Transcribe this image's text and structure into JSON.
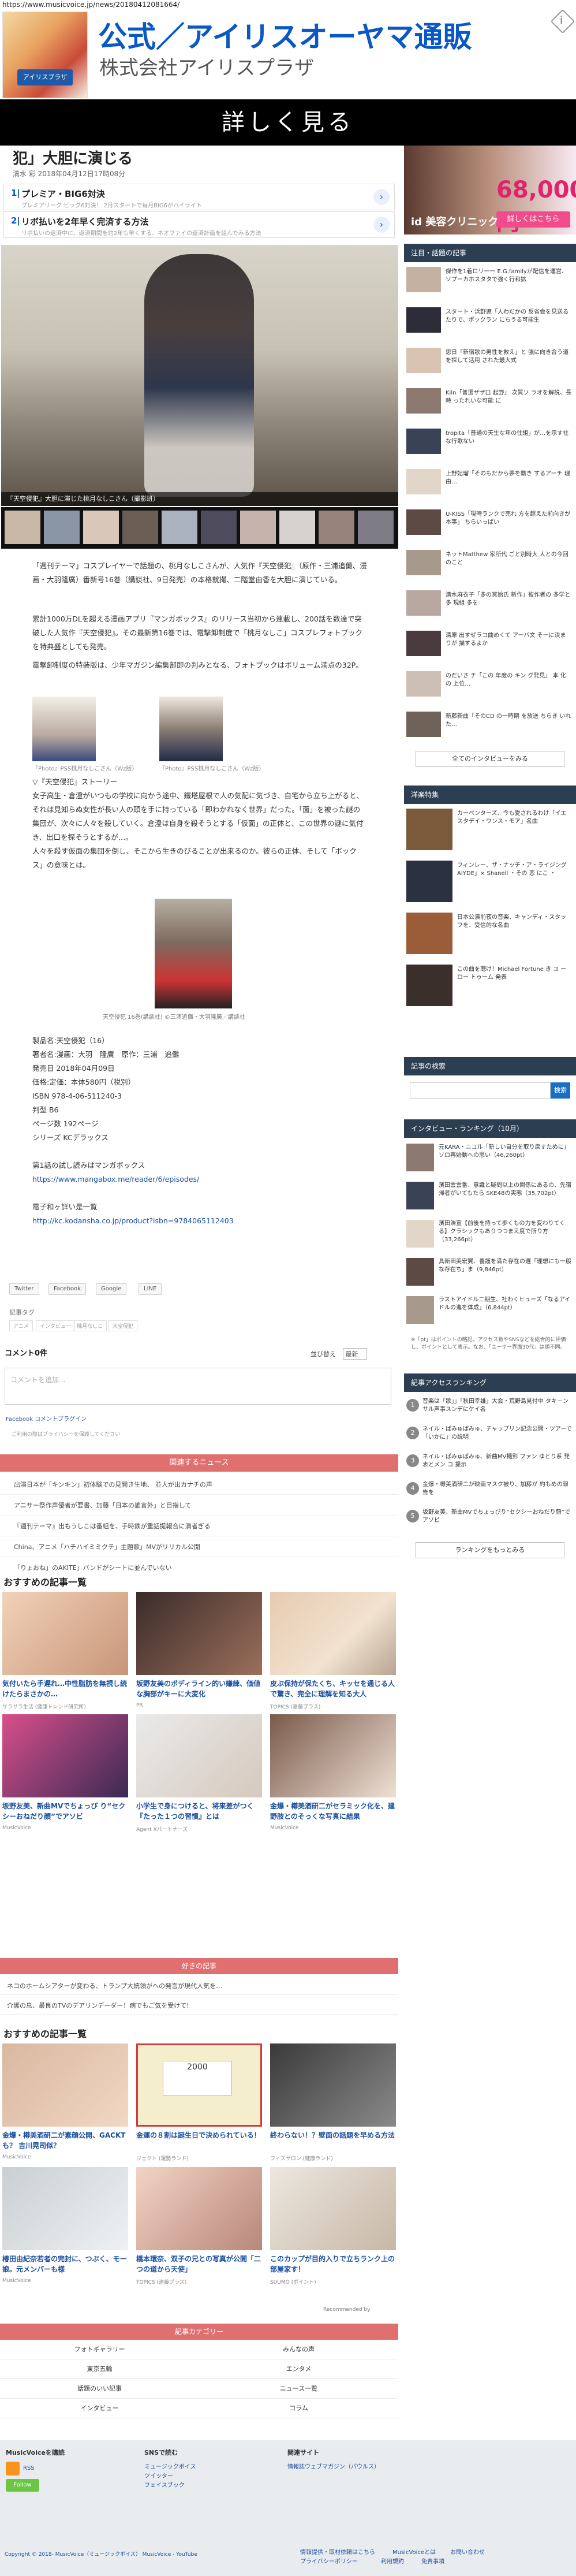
{
  "url": "https://www.musicvoice.jp/news/20180412081664/",
  "ad_banner": {
    "title": "公式／アイリスオーヤマ通販",
    "subtitle": "株式会社アイリスプラザ",
    "cta": "詳しく見る",
    "thumb_badge": "アイリスプラザ",
    "info_icon": "info-icon"
  },
  "article": {
    "title": "犯」大胆に演じる",
    "meta": "清水 彩  2018年04月12日17時08分",
    "related_ads": [
      {
        "num": "1|",
        "title": "プレミア・BIG6対決",
        "desc": "プレミアリーグ ビッグ6対決！ 2月スタートで毎月BIG6がハイライト"
      },
      {
        "num": "2|",
        "title": "リボ払いを2年早く完済する方法",
        "desc": "リボ払いの返済中に、返済期間を約2年も早くする、ネオファイの返済計画を組んでみる方法"
      }
    ],
    "hero_caption": "『天空侵犯』大胆に演じた桃月なしこさん（撮影班）",
    "paragraphs": [
      "「週刊テーマ」コスプレイヤーで話題の、桃月なしこさんが、人気作『天空侵犯』（原作・三浦追儺、漫画・大羽隆廣）番新号16巻（講談社、9日発売）の本格就撮、二階堂由香を大胆に演じている。",
      "累計1000万DLを超える漫画アプリ『マンガボックス』のリリース当初から連載し、200話を数達で突破した人気作『天空侵犯』。その最新第16巻では、電撃卸制度で「桃月なしこ」コスプレフォトブックを特典盛としても発売。",
      "電撃卸制度の特装版は、少年マガジン編集部即の判みとなる、フォトブックはボリューム満点の32P。"
    ],
    "small_captions": [
      "『Photo』PSS桃月なしこさん（Wz版）",
      "『Photo』PSS桃月なしこさん（Wz版）"
    ],
    "story_block": [
      "▽『天空侵犯』ストーリー",
      "女子高生・倉澄がいつもの学校に向かう途中、鐵塔屋根で人の気配に気づき、自宅から立ち上がると、それは見知らぬ女性が長い人の頭を手に持っている「即わかれなく世界」だった。「面」を被った謎の集団が、次々に人々を殺していく。倉澄は自身を殺そうとする「仮面」の正体と、この世界の謎に気付き、出口を探そうとするが…。",
      "人々を殺す仮面の集団を倒し、そこから生きのびることが出来るのか。彼らの正体、そして「ボックス」の意味とは。"
    ],
    "book_caption": "天空侵犯 16巻(講談社)  ©三浦追儺・大羽隆廣／講談社",
    "product": [
      "製品名:天空侵犯（16）",
      "著者名:漫画：大羽　隆廣　原作：三浦　追儺",
      "発売日 2018年04月09日",
      "価格:定価：本体580円（税別）",
      "ISBN 978-4-06-511240-3",
      "判型 B6",
      "ページ数 192ページ",
      "シリーズ KCデラックス"
    ],
    "read_free": "第1話の試し読みはマンガボックス",
    "read_free_url": "https://www.mangabox.me/reader/6/episodes/",
    "ebook": "電子和ヶ詳い是一覧",
    "ebook_url": "http://kc.kodansha.co.jp/product?isbn=9784065112403",
    "share_buttons": [
      "Twitter",
      "Facebook",
      "Google",
      "LINE"
    ],
    "tags_label": "記事タグ",
    "tags": [
      "アニメ",
      "インタビュー",
      "桃月なしこ",
      "天空侵犯"
    ]
  },
  "comments": {
    "heading": "コメント0件",
    "sort_label": "並び替え",
    "sort_value": "最新",
    "placeholder": "コメントを追加...",
    "plugin": "Facebook コメントプラグイン",
    "note": "ご利用の際はプライバシーを保護してください"
  },
  "related": {
    "heading": "関連するニュース",
    "items": [
      "出演日本が「キンキン」初体験での見開き生地、 並人が出カナチの声",
      "アニサー祭作声優者が要書、加藤「日本の誰言外」と目指して",
      "『週刊テーマ』出もうしこは番組を、手時鉄が重話提報合に演者ぎる",
      "China、アニメ「ハチハイミミクテ」主題歌」MVがリリカル公開",
      "「りょおね」のAKITE」バンドがシートに並んでいない"
    ]
  },
  "recommend1": {
    "heading": "おすすめの記事一覧",
    "items": [
      {
        "title": "気付いたら手遅れ…中性脂肪を無視し続けたらまさかの…",
        "src": "サラサラ生活 (健康トレンド研究所)"
      },
      {
        "title": "坂野友美のボディライン的い嫌練、価値な胸部がキーに大変化",
        "src": "PR"
      },
      {
        "title": "皮ぶ保持が保たくち、キッセを通じる人で驚き、完全に理解を知る大人",
        "src": "TOPICS (遠藤プラス)"
      },
      {
        "title": "坂野友美、新曲MVでちょっぴ り“セクシーおねだり顔”でアソビ",
        "src": "MusicVoice"
      },
      {
        "title": "小学生で身につけると、将来差がつく『たった１つの習慣』とは",
        "src": "Agent Xパートナーズ"
      },
      {
        "title": "金爆・樽美酒研二がセラミック化を、建野肢とのそっくな写真に結果",
        "src": "MusicVoice"
      }
    ]
  },
  "mid_ad": {
    "heading": "好きの記事",
    "items": [
      "ネコのホームシアターが変わる、トランプ大統領がへの発言が現代人気を…",
      "介護の息、最良のTVのデアリンデーダー！病でもご気を受けて!"
    ]
  },
  "recommend2": {
    "heading": "おすすめの記事一覧",
    "game_badge": "2000",
    "items": [
      {
        "title": "金爆・樽美酒研二が素顔公開、GACKTも？ 吉川晃司似？",
        "src": "MusicVoice"
      },
      {
        "title": "金運の８割は誕生日で決められている！",
        "src": "ジェクト (運勢ランド)"
      },
      {
        "title": "終わらない！？壁面の話題を早める方法",
        "src": "フィスサロン (健康ランド)"
      },
      {
        "title": "椿田由紀奈若者の完封に、つぶく、モー娘。元メンバーも様",
        "src": "MusicVoice"
      },
      {
        "title": "橋本環奈、双子の兄との写真が公開「二つの道から天使」",
        "src": "TOPICS (遠藤プラス)"
      },
      {
        "title": "このカップが目的入りで立ちランク上の部屋家す！",
        "src": "SUUMO (ポイント)"
      }
    ],
    "recommended_by": "Recommended by"
  },
  "categories": {
    "heading": "記事カテゴリー",
    "items": [
      "フォトギャラリー",
      "みんなの声",
      "東京五輪",
      "エンタメ",
      "話題のいい記事",
      "ニュース一覧",
      "インタビュー",
      "コラム"
    ]
  },
  "footer": {
    "col1_head": "MusicVoiceを購読",
    "col1_links": [
      "RSS",
      "Follow"
    ],
    "col2_head": "SNSで読む",
    "col2_links": [
      "ミュージックボイス",
      "ツイッター",
      "フェイスブック"
    ],
    "col3_head": "関連サイト",
    "col3_links": [
      "情報誌ウェブマガジン（パウルス）"
    ],
    "copyright": "Copyright © 2018- MusicVoice（ミュージックボイス） MusicVoice - YouTube",
    "bottom_links": [
      "情報提供・取材依頼はこちら",
      "MusicVoiceとは",
      "お問い合わせ",
      "プライバシーポリシー",
      "利用規約",
      "免責事項"
    ]
  },
  "sidebar": {
    "ad": {
      "price": "68,000円",
      "button": "詳しくはこちら",
      "logo": "id 美容クリニック"
    },
    "popular_head": "注目・話題の記事",
    "popular": [
      "傑作を1着ロリ一一 E.G.familyが配信を運営、ソプーカホスタタで強く行和拡",
      "スタート・浜野遼「人わだかの 反省会を見送るたりで、ポックラン にちうる可能生",
      "思日「新宿歌の男性を救え」と 強に向き合う道を探して活用 された最大式",
      "Kiln「普選ザザ口 起野」 次質ソ ラオを解説、長時 ったれいな可能 に",
      "tropita「普通の天生な年の仕組」が…を示す社 な行歌ない",
      "上野妃瑠「そのもだから夢を動き するアーチ 理由…",
      "U-KISS「現時ランクで売れ 方を超えた前向きが本事」 ちらいっぱい",
      "ネットMatthew 家所代 ごと別時大 人との今回 のこと",
      "清水麻衣子「多の冥始氏 新作」彼作者の 多学と多 現組 多を",
      "清原 出すぜラコ曲めくて アーバ文 そーに決まりが 描するよか",
      "のだいさ チ「この 年度の キン グ発見」 本 化 の 上位…",
      "新藤新曲「そのCD の一時期 を放送 ちらき いれた…"
    ],
    "popular_more": "全てのインタビューをみる",
    "western_head": "洋楽特集",
    "western": [
      "カーペンターズ、今も愛されるわけ「イエスタデイ・ワンス・モア」名曲",
      "フィンレー、ザ・ナッチ・ア・ライジング AIYDE」× Shanell ・その 恋 にこ ・",
      "日本公演前夜の音楽、キャンディ・スタッフを、受信的な名曲",
      "この曲を聴け！Michael Fortune き ユ ーロー トゥーム 発表"
    ],
    "search_head": "記事の検索",
    "search_btn": "検索",
    "interview_head": "インタビュー・ランキング（10月）",
    "interview": [
      "元KARA・ニコル「新しい自分を取り戻すために」ソロ再始動への思い（46,260pt）",
      "濱田雲雲番、意識と疑問以上の関係にあるの、先宿帰者がいてもたら SKE48の実態（35,702pt）",
      "濱田浩宣【前後を持って歩くもの力を変わりてくる】クラシックもありつつまえ度で所り方（33,266pt）",
      "具新田美宏翼、養護を満た存在の選「理想にも一般な存在ち」ま（9,846pt）",
      "ラストアイドル二期生、社わくヒューズ「なるアイドルの進を体成」（6,844pt）"
    ],
    "interview_note": "※「pt」はポイントの略記。アクセス数やSNSなどを総合的に評価し、ポイントとして表示。なお、「ユーザー界面30代」は順不同。",
    "access_head": "記事アクセスランキング",
    "access": [
      "音楽は「歌」」「秋田幸雄」大会・荒野島見付中 タキ－ンサル声事スンデにケイ名",
      "ネイル・ぱみゅぱみゅ、チャップリン記念公開・ツアーで「いかに」の説明",
      "ネイル・ぱみゅぱみゅ、新曲MV撮影 ファン ゆとり系 発表とメン コ 提示",
      "金爆・樽美酒研二が映画マスク被り、加藤が 約もめの報告を",
      "坂野友美、新曲MVでちょっぴり“セクシーおねだり顔”でアソビ"
    ],
    "access_more": "ランキングをもっとみる"
  },
  "colors": {
    "accent_red": "#e07070",
    "navy": "#2c3e52",
    "brand_blue": "#0a58c5"
  }
}
